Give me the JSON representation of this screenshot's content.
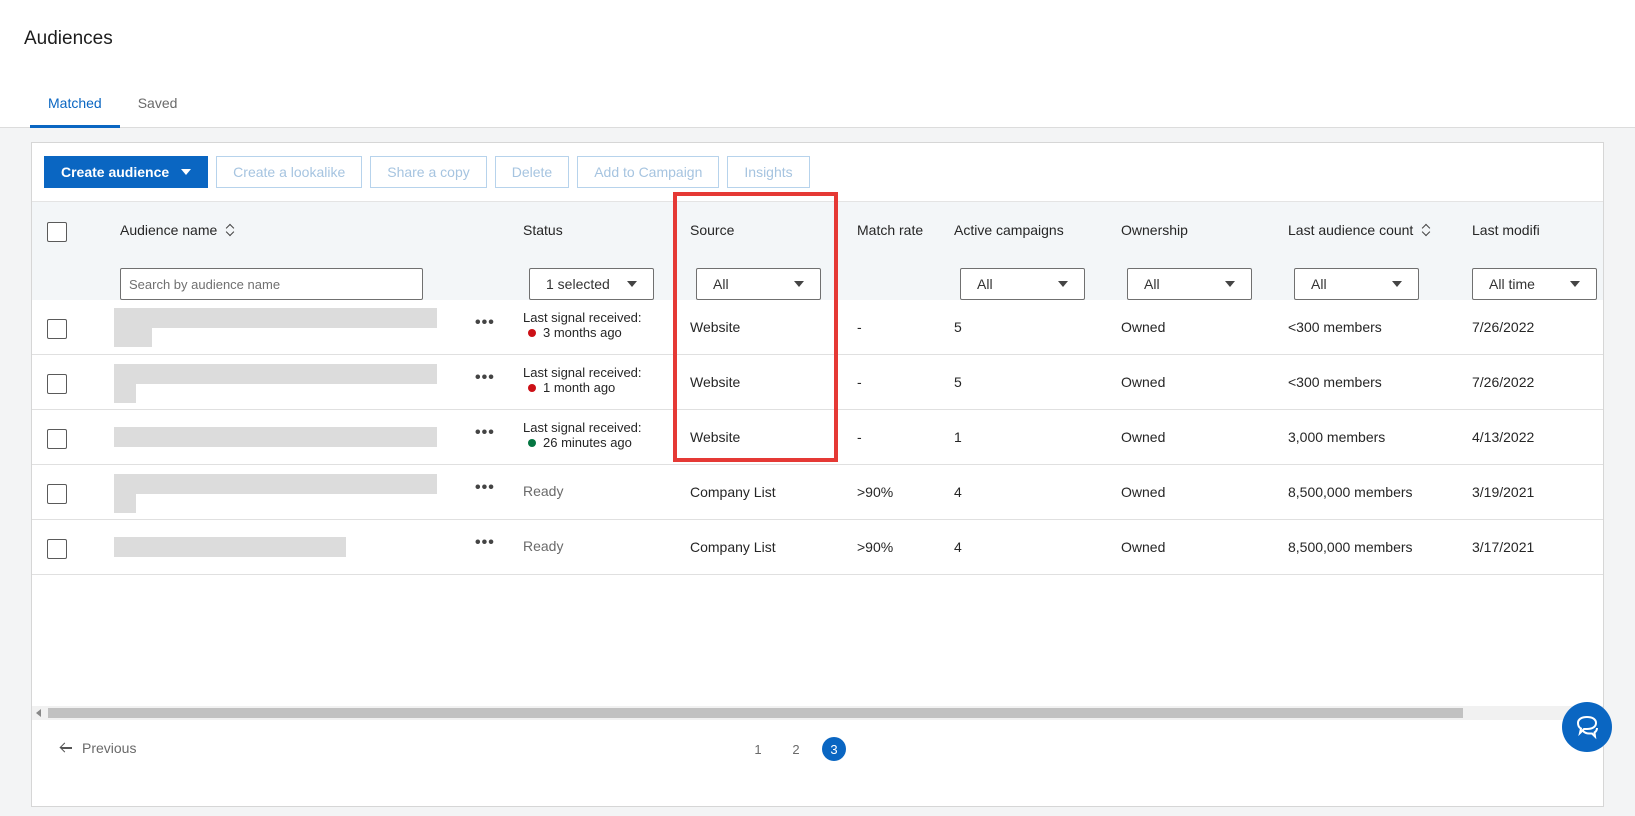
{
  "page": {
    "title": "Audiences",
    "tabs": [
      {
        "label": "Matched",
        "active": true
      },
      {
        "label": "Saved",
        "active": false
      }
    ]
  },
  "toolbar": {
    "create_audience": "Create audience",
    "create_lookalike": "Create a lookalike",
    "share_copy": "Share a copy",
    "delete": "Delete",
    "add_to_campaign": "Add to Campaign",
    "insights": "Insights"
  },
  "table": {
    "headers": {
      "audience_name": "Audience name",
      "status": "Status",
      "source": "Source",
      "match_rate": "Match rate",
      "active_campaigns": "Active campaigns",
      "ownership": "Ownership",
      "last_audience_count": "Last audience count",
      "last_modified": "Last modifi"
    },
    "filters": {
      "search_placeholder": "Search by audience name",
      "status": "1 selected",
      "source": "All",
      "active_campaigns": "All",
      "ownership": "All",
      "last_audience_count": "All",
      "last_modified": "All time"
    },
    "rows": [
      {
        "status_label": "Last signal received:",
        "status_time": "3 months ago",
        "status_color": "#cc1016",
        "source": "Website",
        "match_rate": "-",
        "active_campaigns": "5",
        "ownership": "Owned",
        "count": "<300 members",
        "modified": "7/26/2022"
      },
      {
        "status_label": "Last signal received:",
        "status_time": "1 month ago",
        "status_color": "#cc1016",
        "source": "Website",
        "match_rate": "-",
        "active_campaigns": "5",
        "ownership": "Owned",
        "count": "<300 members",
        "modified": "7/26/2022"
      },
      {
        "status_label": "Last signal received:",
        "status_time": "26 minutes ago",
        "status_color": "#057642",
        "source": "Website",
        "match_rate": "-",
        "active_campaigns": "1",
        "ownership": "Owned",
        "count": "3,000 members",
        "modified": "4/13/2022"
      },
      {
        "status": "Ready",
        "source": "Company List",
        "match_rate": ">90%",
        "active_campaigns": "4",
        "ownership": "Owned",
        "count": "8,500,000 members",
        "modified": "3/19/2021"
      },
      {
        "status": "Ready",
        "source": "Company List",
        "match_rate": ">90%",
        "active_campaigns": "4",
        "ownership": "Owned",
        "count": "8,500,000 members",
        "modified": "3/17/2021"
      }
    ]
  },
  "pagination": {
    "previous": "Previous",
    "pages": [
      "1",
      "2",
      "3"
    ],
    "current": "3"
  },
  "colors": {
    "accent": "#0a66c2",
    "highlight": "#e53935"
  },
  "icons": {
    "chat": "chat-bubble-icon",
    "sort": "sort-icon",
    "prev": "arrow-left-icon"
  }
}
